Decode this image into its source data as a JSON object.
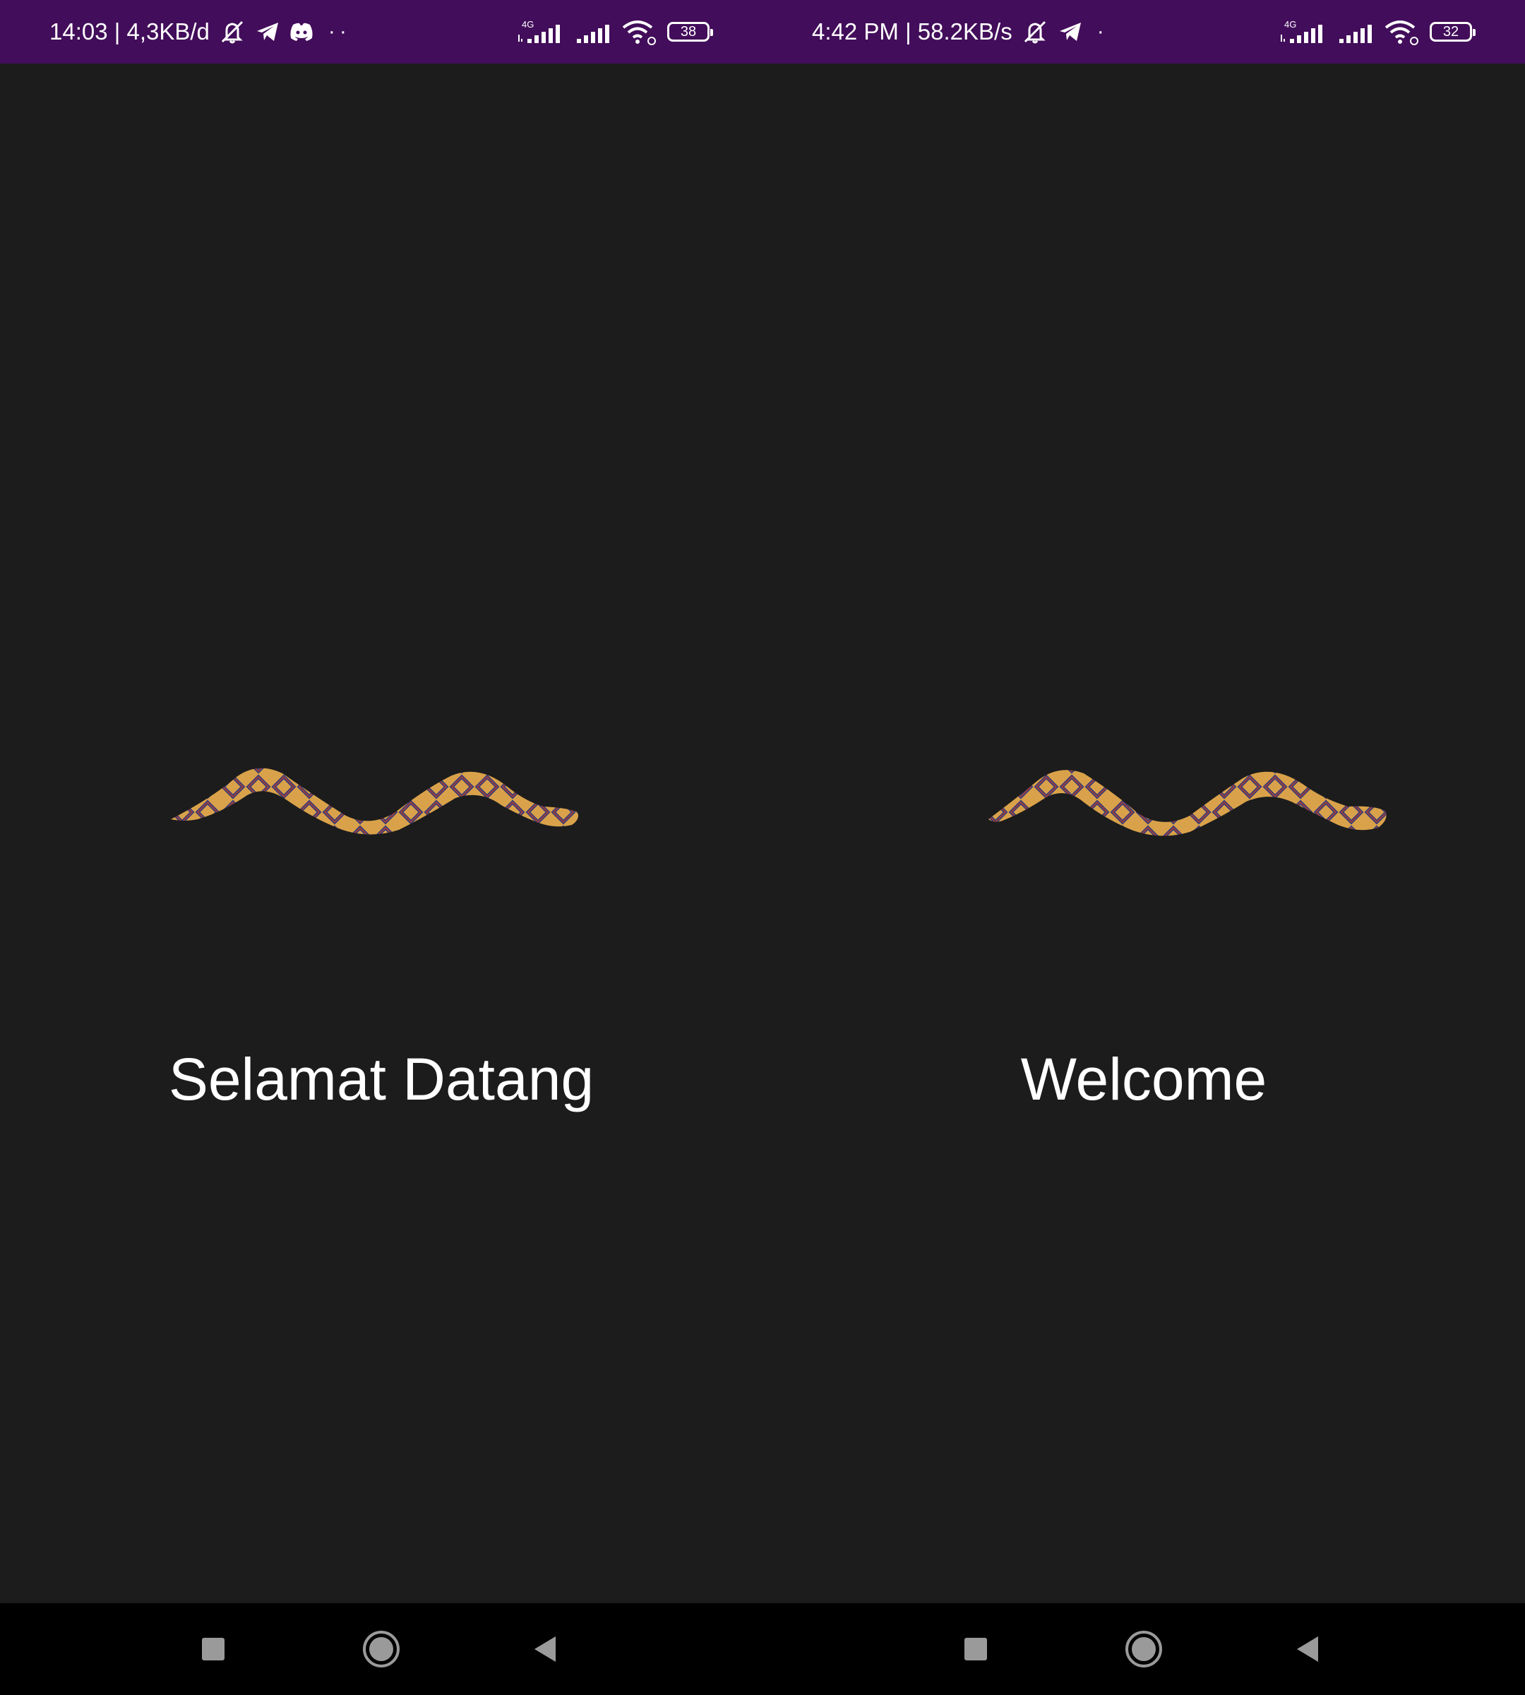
{
  "screens": [
    {
      "status": {
        "time_info": "14:03 | 4,3KB/d",
        "battery": "38",
        "network_label": "4G",
        "extra_icons": [
          "mute-icon",
          "telegram-icon",
          "discord-icon"
        ],
        "overflow": "··"
      },
      "title": "Selamat Datang",
      "illustration": "snake"
    },
    {
      "status": {
        "time_info": "4:42 PM | 58.2KB/s",
        "battery": "32",
        "network_label": "4G",
        "extra_icons": [
          "mute-icon",
          "telegram-icon"
        ],
        "overflow": "·"
      },
      "title": "Welcome",
      "illustration": "snake"
    }
  ],
  "colors": {
    "status_bar": "#420d5a",
    "background": "#1c1c1c",
    "nav_bar": "#000000",
    "snake_body": "#d9a24a",
    "snake_pattern": "#3a3c78"
  },
  "nav": [
    "recents-button",
    "home-button",
    "back-button"
  ]
}
